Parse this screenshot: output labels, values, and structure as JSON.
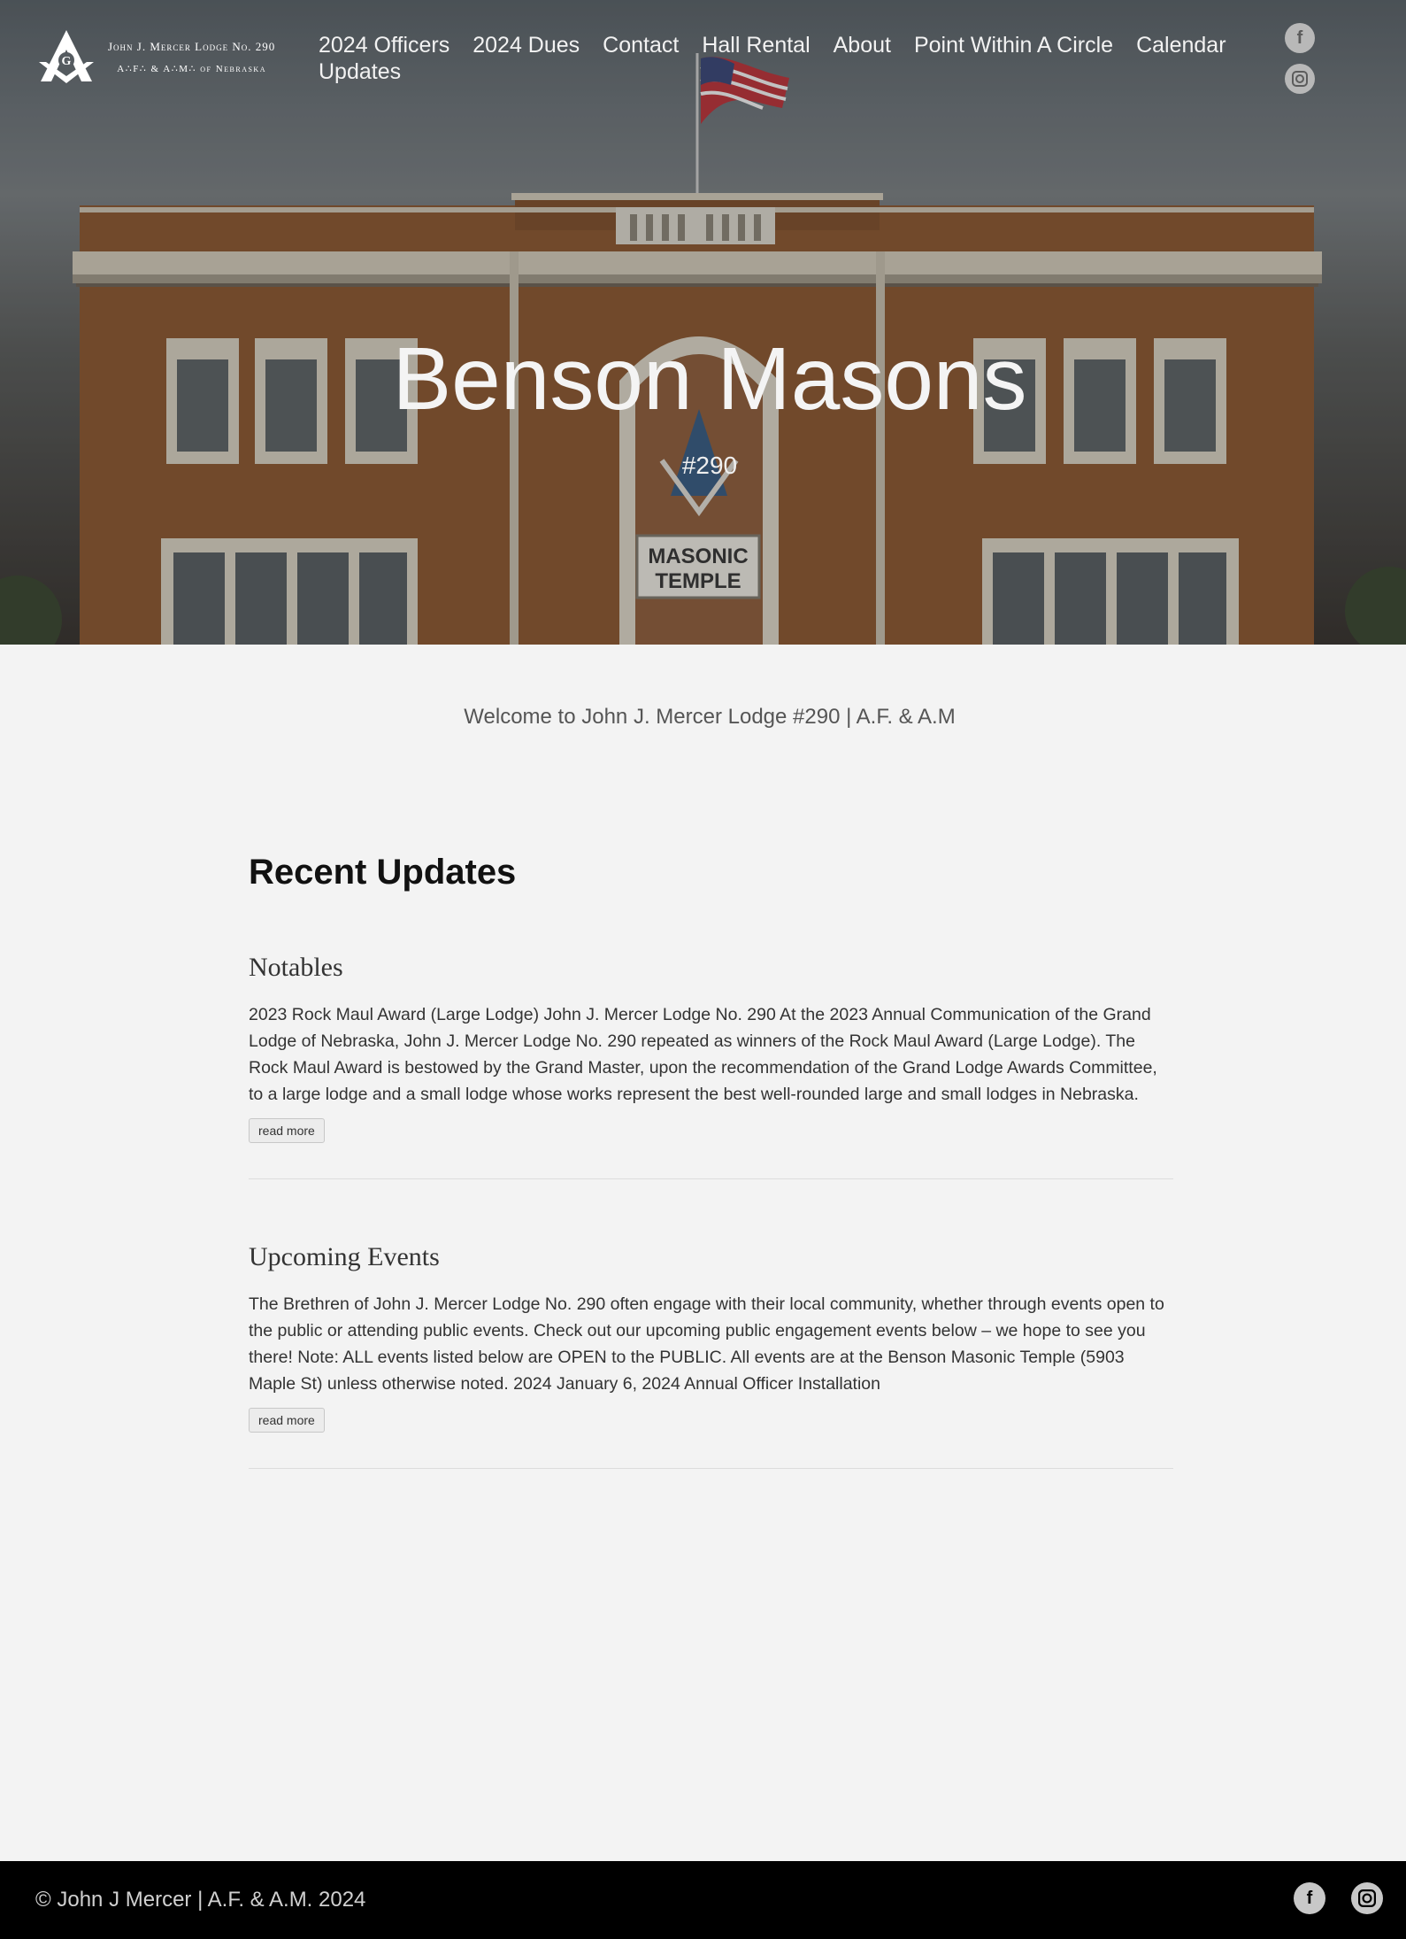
{
  "header": {
    "logo_line1": "John J. Mercer Lodge No. 290",
    "logo_line2": "A∴F∴ & A∴M∴ of Nebraska",
    "nav": [
      "2024 Officers",
      "2024 Dues",
      "Contact",
      "Hall Rental",
      "About",
      "Point Within A Circle",
      "Calendar",
      "Updates"
    ],
    "social": [
      "facebook-icon",
      "instagram-icon"
    ]
  },
  "hero": {
    "title": "Benson Masons",
    "subtitle": "#290",
    "sign_text": [
      "MASONIC",
      "TEMPLE"
    ]
  },
  "welcome": "Welcome to John J. Mercer Lodge #290 | A.F. & A.M",
  "updates": {
    "heading": "Recent Updates",
    "posts": [
      {
        "title": "Notables",
        "excerpt": "2023 Rock Maul Award (Large Lodge) John J. Mercer Lodge No. 290 At the 2023 Annual Communication of the Grand Lodge of Nebraska, John J. Mercer Lodge No. 290 repeated as winners of the Rock Maul Award (Large Lodge). The Rock Maul Award is bestowed by the Grand Master, upon the recommendation of the Grand Lodge Awards Committee, to a large lodge and a small lodge whose works represent the best well-rounded large and small lodges in Nebraska.",
        "button": "read more"
      },
      {
        "title": "Upcoming Events",
        "excerpt": "The Brethren of John J. Mercer Lodge No. 290 often engage with their local community, whether through events open to the public or attending public events. Check out our upcoming public engagement events below – we hope to see you there! Note: ALL events listed below are OPEN to the PUBLIC. All events are at the Benson Masonic Temple (5903 Maple St) unless otherwise noted. 2024 January 6, 2024 Annual Officer Installation",
        "button": "read more"
      }
    ]
  },
  "footer": {
    "copyright": "© John J Mercer | A.F. & A.M. 2024"
  },
  "colors": {
    "page_bg": "#f3f3f3",
    "footer_bg": "#000000",
    "brick": "#8a5a35"
  }
}
